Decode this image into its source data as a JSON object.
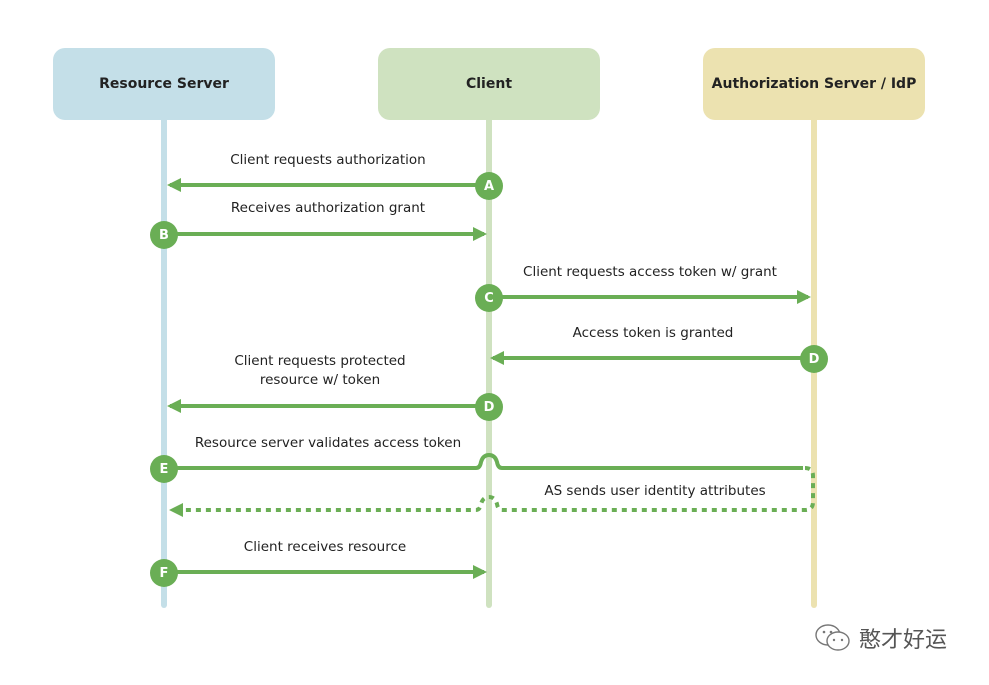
{
  "actors": [
    {
      "id": "resource-server",
      "label": "Resource Server",
      "color": "#c4dfe8",
      "lane_color": "#c4dfe8"
    },
    {
      "id": "client",
      "label": "Client",
      "color": "#cfe2c0",
      "lane_color": "#cfe2c0"
    },
    {
      "id": "authorization-server",
      "label": "Authorization Server / IdP",
      "color": "#ece2b0",
      "lane_color": "#ece2b0"
    }
  ],
  "accent_color": "#6aae55",
  "messages": [
    {
      "step": "A",
      "label": "Client requests authorization",
      "from": "client",
      "to": "resource-server",
      "style": "solid"
    },
    {
      "step": "B",
      "label": "Receives authorization grant",
      "from": "resource-server",
      "to": "client",
      "style": "solid"
    },
    {
      "step": "C",
      "label": "Client requests access token w/ grant",
      "from": "client",
      "to": "authorization-server",
      "style": "solid"
    },
    {
      "step": "D",
      "label": "Access token is granted",
      "from": "authorization-server",
      "to": "client",
      "style": "solid"
    },
    {
      "step": "D",
      "label_lines": [
        "Client requests protected",
        "resource w/ token"
      ],
      "from": "client",
      "to": "resource-server",
      "style": "solid"
    },
    {
      "step": "E",
      "label": "Resource server validates access token",
      "from": "resource-server",
      "to": "authorization-server",
      "style": "solid"
    },
    {
      "step": "",
      "label": "AS sends user identity attributes",
      "from": "authorization-server",
      "to": "resource-server",
      "style": "dotted"
    },
    {
      "step": "F",
      "label": "Client receives resource",
      "from": "resource-server",
      "to": "client",
      "style": "solid"
    }
  ],
  "watermark": {
    "icon": "wechat-icon",
    "text": "憨才好运"
  }
}
